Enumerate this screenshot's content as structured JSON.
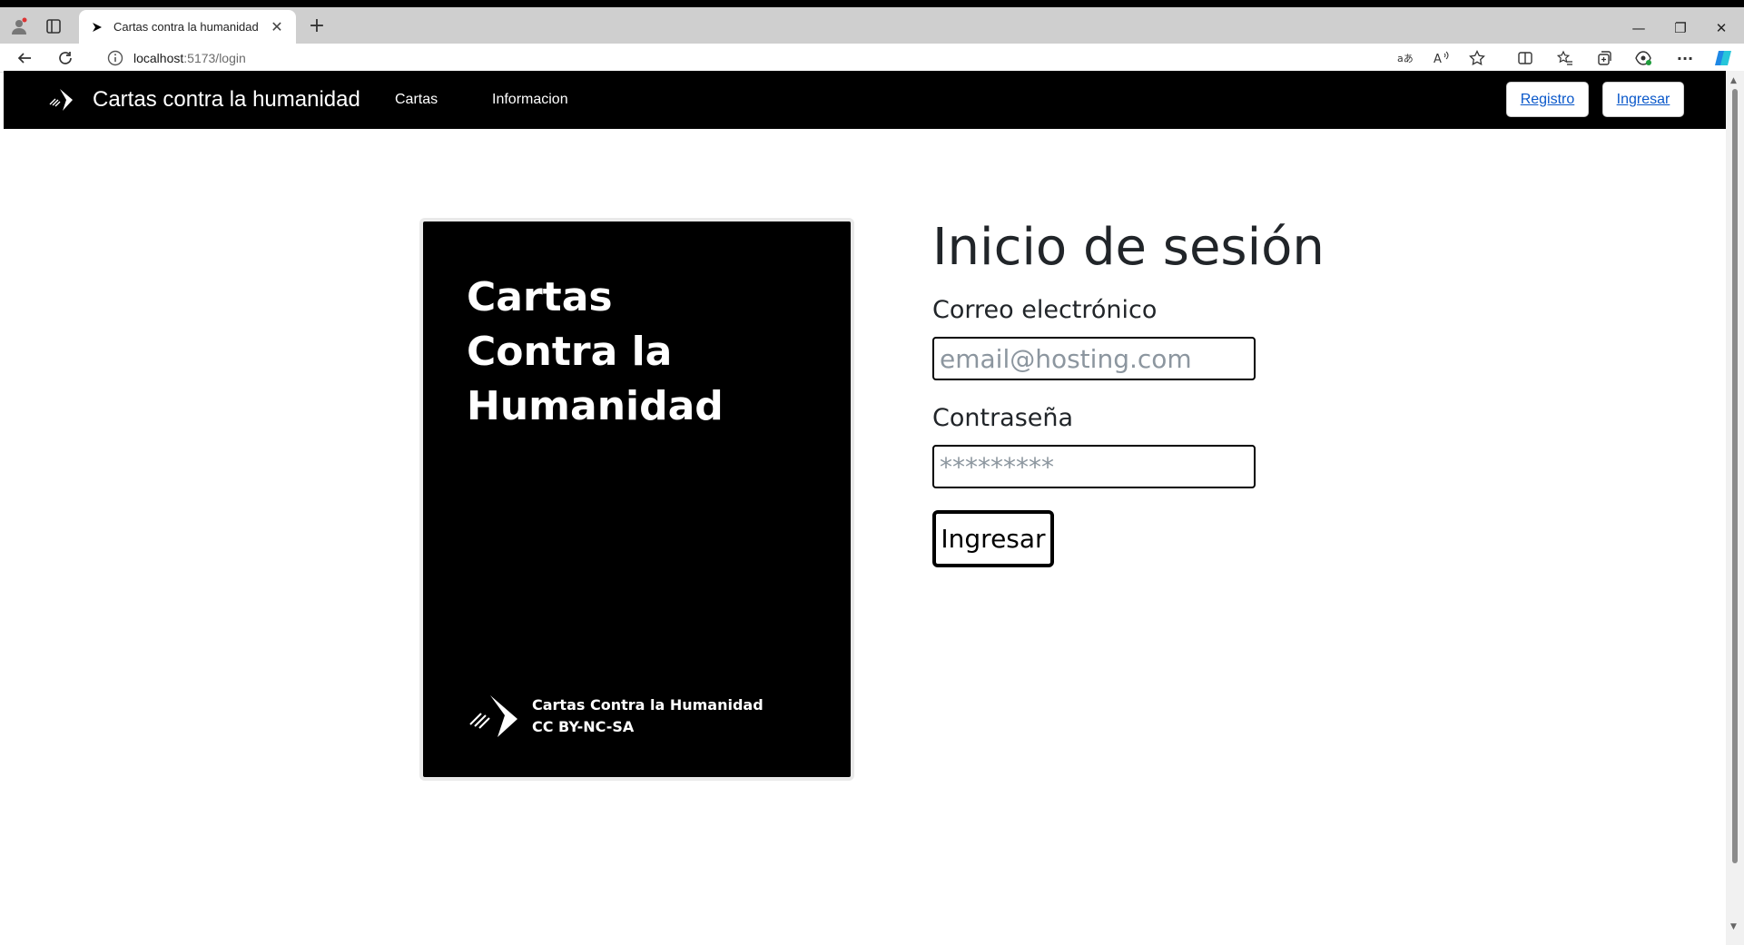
{
  "browser": {
    "tab_title": "Cartas contra la humanidad",
    "tab_close": "✕",
    "new_tab": "+",
    "url_host": "localhost",
    "url_path": ":5173/login",
    "window_controls": {
      "minimize": "—",
      "restore": "❐",
      "close": "✕"
    }
  },
  "navbar": {
    "brand": "Cartas contra la humanidad",
    "links": [
      "Cartas",
      "Informacion"
    ],
    "register": "Registro",
    "login": "Ingresar"
  },
  "card": {
    "title_lines": [
      "Cartas",
      "Contra la",
      "Humanidad"
    ],
    "footer_name": "Cartas Contra la Humanidad",
    "footer_license": "CC BY-NC-SA"
  },
  "login": {
    "heading": "Inicio de sesión",
    "email_label": "Correo electrónico",
    "email_placeholder": "email@hosting.com",
    "password_label": "Contraseña",
    "password_placeholder": "*********",
    "submit": "Ingresar"
  }
}
